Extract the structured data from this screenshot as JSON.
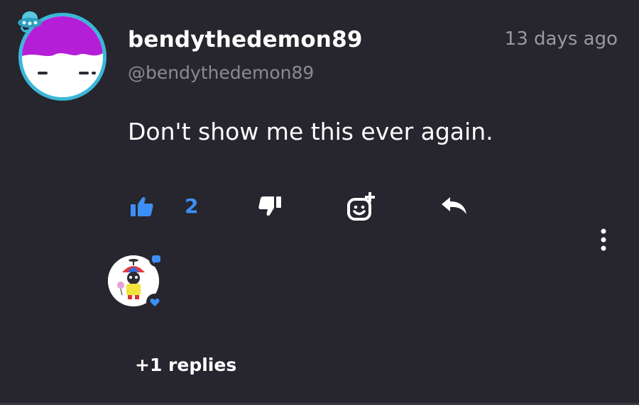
{
  "comment": {
    "username": "bendythedemon89",
    "handle": "@bendythedemon89",
    "time": "13 days ago",
    "text": "Don't show me this ever again.",
    "like_count": "2",
    "replies_label": "+1 replies"
  },
  "icons": {
    "avatar": "ufo-badge-avatar",
    "like": "thumbs-up-icon",
    "dislike": "thumbs-down-icon",
    "emoji": "add-emoji-icon",
    "reply": "reply-arrow-icon",
    "more": "more-vertical-icon",
    "reply_badge_top": "chat-bubble-icon",
    "reply_badge_bottom": "heart-icon"
  },
  "colors": {
    "background": "#27252d",
    "accent": "#3d8ff5",
    "avatar_ring": "#3ab7d9",
    "avatar_hair": "#b41ed6",
    "muted_text": "#8b8993"
  }
}
